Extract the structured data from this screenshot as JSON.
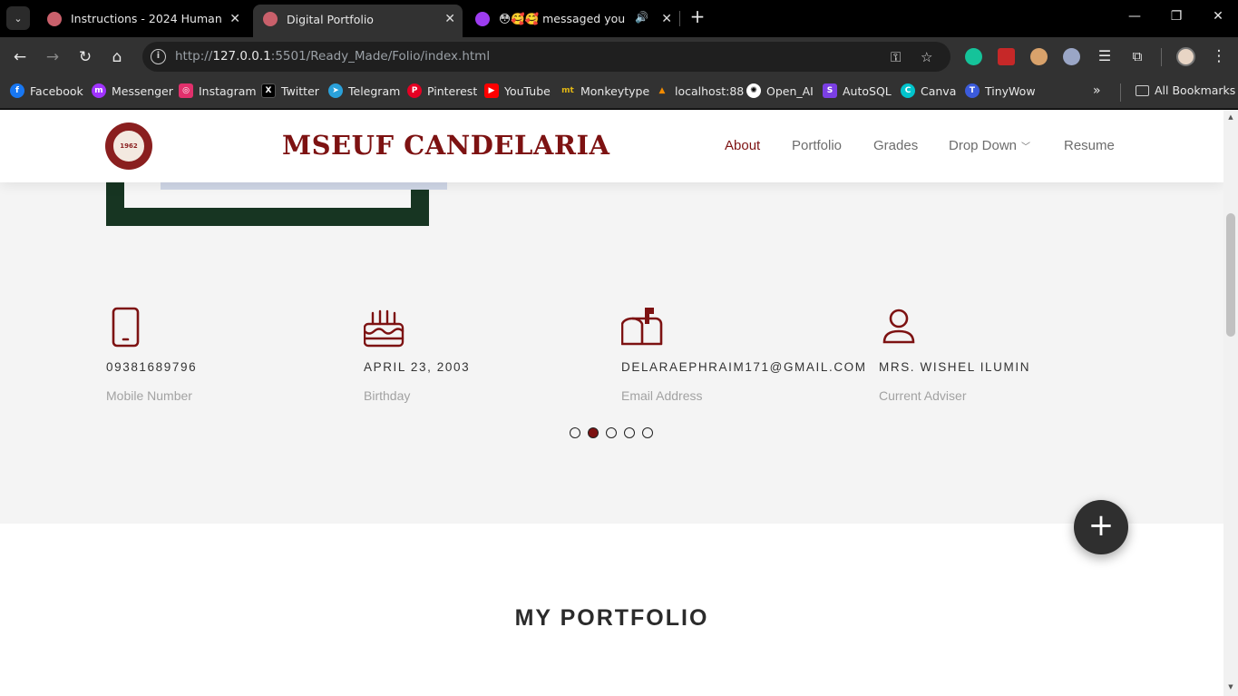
{
  "tabs": [
    {
      "title": "Instructions - 2024 Human Com",
      "active": false
    },
    {
      "title": "Digital Portfolio",
      "active": true
    },
    {
      "title": "😳🥰🥰 messaged you",
      "active": false
    }
  ],
  "address_bar": {
    "url_prefix": "http://",
    "url_host": "127.0.0.1",
    "url_rest": ":5501/Ready_Made/Folio/index.html"
  },
  "bookmarks": [
    {
      "label": "Facebook",
      "color": "#1877f2",
      "glyph": "f"
    },
    {
      "label": "Messenger",
      "color": "#a033ff",
      "glyph": "m"
    },
    {
      "label": "Instagram",
      "color": "#e1306c",
      "glyph": "◎"
    },
    {
      "label": "Twitter",
      "color": "#000000",
      "glyph": "X"
    },
    {
      "label": "Telegram",
      "color": "#2aa1da",
      "glyph": "➤"
    },
    {
      "label": "Pinterest",
      "color": "#e60023",
      "glyph": "P"
    },
    {
      "label": "YouTube",
      "color": "#ff0000",
      "glyph": "▶"
    },
    {
      "label": "Monkeytype",
      "color": "#323232",
      "glyph": "mt"
    },
    {
      "label": "localhost:88",
      "color": "#f28b00",
      "glyph": "▲"
    },
    {
      "label": "Open_AI",
      "color": "#ffffff",
      "glyph": "✺"
    },
    {
      "label": "AutoSQL",
      "color": "#7b3fe4",
      "glyph": "S"
    },
    {
      "label": "Canva",
      "color": "#00c4cc",
      "glyph": "C"
    },
    {
      "label": "TinyWow",
      "color": "#3b5bdb",
      "glyph": "T"
    }
  ],
  "all_bookmarks": "All Bookmarks",
  "site": {
    "brand": "MSEUF CANDELARIA",
    "logo_text": "1962",
    "nav": [
      {
        "label": "About",
        "active": true
      },
      {
        "label": "Portfolio",
        "active": false
      },
      {
        "label": "Grades",
        "active": false
      },
      {
        "label": "Drop Down",
        "active": false
      },
      {
        "label": "Resume",
        "active": false
      }
    ]
  },
  "info": [
    {
      "value": "09381689796",
      "label": "Mobile Number",
      "icon": "phone-icon"
    },
    {
      "value": "APRIL 23, 2003",
      "label": "Birthday",
      "icon": "cake-icon"
    },
    {
      "value": "DELARAEPHRAIM171@GMAIL.COM",
      "label": "Email Address",
      "icon": "mailbox-icon"
    },
    {
      "value": "MRS. WISHEL ILUMIN",
      "label": "Current Adviser",
      "icon": "person-icon"
    }
  ],
  "carousel": {
    "count": 5,
    "active_index": 1
  },
  "portfolio_title": "MY PORTFOLIO",
  "colors": {
    "accent": "#7d1212",
    "frame": "#173522"
  }
}
